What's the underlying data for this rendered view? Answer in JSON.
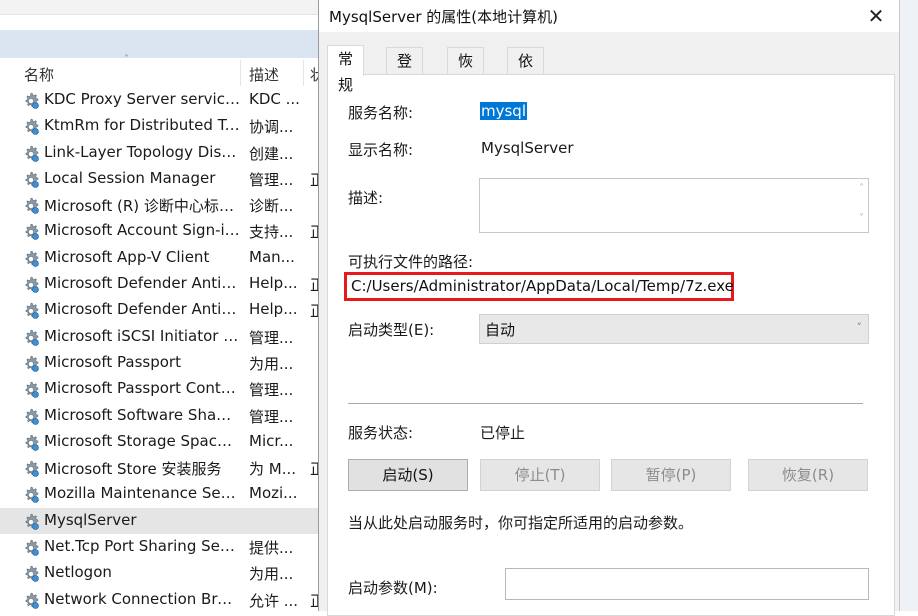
{
  "services_list": {
    "header": {
      "name_col": "名称",
      "desc_col": "描述",
      "status_col": "状"
    },
    "rows": [
      {
        "name": "KDC Proxy Server service (...",
        "desc": "KDC ...",
        "status": ""
      },
      {
        "name": "KtmRm for Distributed Tra...",
        "desc": "协调...",
        "status": ""
      },
      {
        "name": "Link-Layer Topology Disco...",
        "desc": "创建...",
        "status": ""
      },
      {
        "name": "Local Session Manager",
        "desc": "管理...",
        "status": "正"
      },
      {
        "name": "Microsoft (R) 诊断中心标准...",
        "desc": "诊断...",
        "status": ""
      },
      {
        "name": "Microsoft Account Sign-in ...",
        "desc": "支持...",
        "status": "正"
      },
      {
        "name": "Microsoft App-V Client",
        "desc": "Man...",
        "status": ""
      },
      {
        "name": "Microsoft Defender Antivir...",
        "desc": "Help...",
        "status": "正"
      },
      {
        "name": "Microsoft Defender Antivir...",
        "desc": "Help...",
        "status": "正"
      },
      {
        "name": "Microsoft iSCSI Initiator Ser...",
        "desc": "管理...",
        "status": ""
      },
      {
        "name": "Microsoft Passport",
        "desc": "为用...",
        "status": ""
      },
      {
        "name": "Microsoft Passport Container",
        "desc": "管理...",
        "status": ""
      },
      {
        "name": "Microsoft Software Shado...",
        "desc": "管理...",
        "status": ""
      },
      {
        "name": "Microsoft Storage Spaces S...",
        "desc": "Micr...",
        "status": ""
      },
      {
        "name": "Microsoft Store 安装服务",
        "desc": "为 M...",
        "status": "正"
      },
      {
        "name": "Mozilla Maintenance Service",
        "desc": "Mozi...",
        "status": ""
      },
      {
        "name": "MysqlServer",
        "desc": "",
        "status": ""
      },
      {
        "name": "Net.Tcp Port Sharing Service",
        "desc": "提供...",
        "status": ""
      },
      {
        "name": "Netlogon",
        "desc": "为用...",
        "status": ""
      },
      {
        "name": "Network Connection Broker",
        "desc": "允许 ...",
        "status": "正"
      }
    ],
    "selected_index": 16
  },
  "dialog": {
    "title": "MysqlServer 的属性(本地计算机)",
    "close_glyph": "✕",
    "tabs": [
      "常规",
      "登录",
      "恢复",
      "依存关系"
    ],
    "active_tab": 0,
    "service_name_label": "服务名称:",
    "service_name_value": "mysql",
    "display_name_label": "显示名称:",
    "display_name_value": "MysqlServer",
    "description_label": "描述:",
    "description_value": "",
    "exe_path_label": "可执行文件的路径:",
    "exe_path_value": "C:/Users/Administrator/AppData/Local/Temp/7z.exe",
    "startup_type_label": "启动类型(E):",
    "startup_type_value": "自动",
    "service_status_label": "服务状态:",
    "service_status_value": "已停止",
    "buttons": {
      "start": "启动(S)",
      "stop": "停止(T)",
      "pause": "暂停(P)",
      "resume": "恢复(R)"
    },
    "hint": "当从此处启动服务时，你可指定所适用的启动参数。",
    "start_params_label": "启动参数(M):",
    "start_params_value": "",
    "highlight_color": "#e8191c",
    "selection_color": "#0078d7"
  }
}
